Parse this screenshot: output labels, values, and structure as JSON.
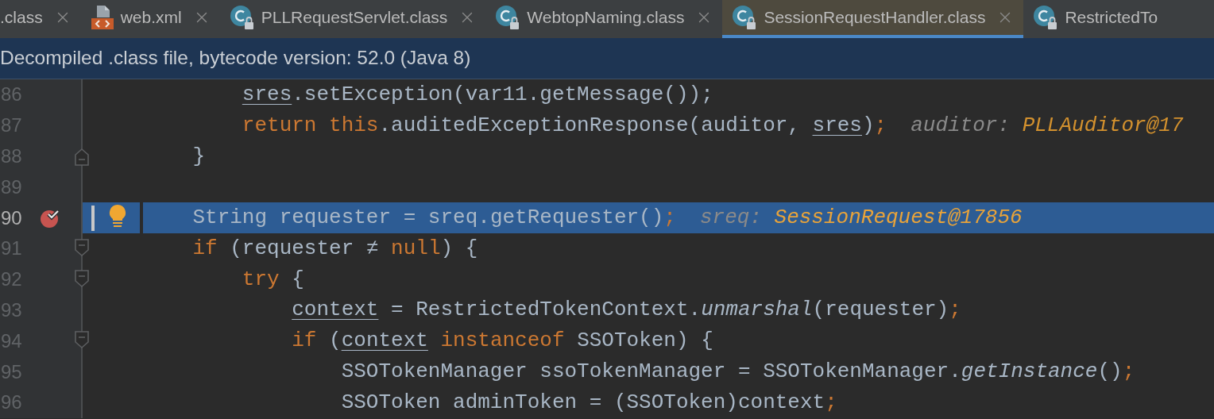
{
  "tabs": [
    {
      "label": ".class",
      "kind": "plain",
      "closable": true,
      "selected": false
    },
    {
      "label": "web.xml",
      "kind": "xml",
      "closable": true,
      "selected": false
    },
    {
      "label": "PLLRequestServlet.class",
      "kind": "class",
      "closable": true,
      "selected": false
    },
    {
      "label": "WebtopNaming.class",
      "kind": "class",
      "closable": true,
      "selected": false
    },
    {
      "label": "SessionRequestHandler.class",
      "kind": "class",
      "closable": true,
      "selected": true
    },
    {
      "label": "RestrictedTo",
      "kind": "class",
      "closable": false,
      "selected": false
    }
  ],
  "banner": "Decompiled .class file, bytecode version: 52.0 (Java 8)",
  "lines": [
    {
      "number": "86",
      "fold_start": false,
      "fold_end": false,
      "breakpoint": false,
      "current": false,
      "tokens": [
        {
          "kind": "field",
          "text": "        sres"
        },
        {
          "kind": "plain",
          "text": ".setException(var11.getMessage());"
        }
      ]
    },
    {
      "number": "87",
      "fold_start": false,
      "fold_end": false,
      "breakpoint": false,
      "current": false,
      "tokens": [
        {
          "kind": "keyword",
          "text": "        return this"
        },
        {
          "kind": "plain",
          "text": ".auditedExceptionResponse(auditor, "
        },
        {
          "kind": "field",
          "text": "sres"
        },
        {
          "kind": "plain",
          "text": ")"
        },
        {
          "kind": "keyword",
          "text": ";"
        }
      ],
      "hint": {
        "label": "auditor:",
        "value": "PLLAuditor@17"
      }
    },
    {
      "number": "88",
      "fold_start": false,
      "fold_end": true,
      "breakpoint": false,
      "current": false,
      "tokens": [
        {
          "kind": "plain",
          "text": "    }"
        }
      ]
    },
    {
      "number": "89",
      "fold_start": false,
      "fold_end": false,
      "breakpoint": false,
      "current": false
    },
    {
      "number": "90",
      "fold_start": false,
      "fold_end": false,
      "breakpoint": true,
      "current": true,
      "tokens": [
        {
          "kind": "plain",
          "text": "    String requester = sreq.getRequester()"
        },
        {
          "kind": "keyword",
          "text": ";"
        }
      ],
      "hint": {
        "label": "sreq:",
        "value": "SessionRequest@17856"
      }
    },
    {
      "number": "91",
      "fold_start": true,
      "fold_end": false,
      "breakpoint": false,
      "current": false,
      "tokens": [
        {
          "kind": "keyword",
          "text": "    if"
        },
        {
          "kind": "plain",
          "text": " (requester ≠ "
        },
        {
          "kind": "keyword",
          "text": "null"
        },
        {
          "kind": "plain",
          "text": ") {"
        }
      ]
    },
    {
      "number": "92",
      "fold_start": true,
      "fold_end": false,
      "breakpoint": false,
      "current": false,
      "tokens": [
        {
          "kind": "keyword",
          "text": "        try"
        },
        {
          "kind": "plain",
          "text": " {"
        }
      ]
    },
    {
      "number": "93",
      "fold_start": false,
      "fold_end": false,
      "breakpoint": false,
      "current": false,
      "tokens": [
        {
          "kind": "field",
          "text": "            context"
        },
        {
          "kind": "plain",
          "text": " = RestrictedTokenContext."
        },
        {
          "kind": "method",
          "text": "unmarshal"
        },
        {
          "kind": "plain",
          "text": "(requester)"
        },
        {
          "kind": "keyword",
          "text": ";"
        }
      ]
    },
    {
      "number": "94",
      "fold_start": true,
      "fold_end": false,
      "breakpoint": false,
      "current": false,
      "tokens": [
        {
          "kind": "keyword",
          "text": "            if"
        },
        {
          "kind": "plain",
          "text": " ("
        },
        {
          "kind": "field",
          "text": "context"
        },
        {
          "kind": "keyword",
          "text": " instanceof"
        },
        {
          "kind": "plain",
          "text": " SSOToken) {"
        }
      ]
    },
    {
      "number": "95",
      "fold_start": false,
      "fold_end": false,
      "breakpoint": false,
      "current": false,
      "tokens": [
        {
          "kind": "plain",
          "text": "                SSOTokenManager ssoTokenManager = SSOTokenManager."
        },
        {
          "kind": "method",
          "text": "getInstance"
        },
        {
          "kind": "plain",
          "text": "()"
        },
        {
          "kind": "keyword",
          "text": ";"
        }
      ]
    },
    {
      "number": "96",
      "fold_start": false,
      "fold_end": false,
      "breakpoint": false,
      "current": false,
      "tokens": [
        {
          "kind": "plain",
          "text": "                SSOToken adminToken = (SSOToken)context"
        },
        {
          "kind": "keyword",
          "text": ";"
        }
      ]
    }
  ]
}
